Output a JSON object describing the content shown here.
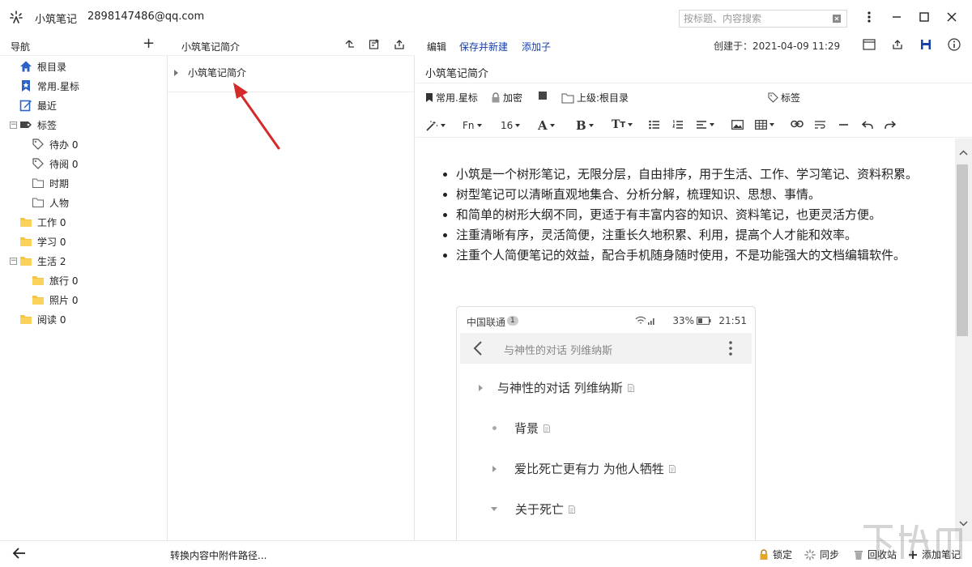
{
  "app": {
    "title": "小筑笔记",
    "user_email": "2898147486@qq.com",
    "search_placeholder": "按标题、内容搜索"
  },
  "nav": {
    "header": "导航",
    "items": [
      {
        "label": "根目录",
        "icon": "home-icon",
        "level": 0
      },
      {
        "label": "常用.星标",
        "icon": "bookmark-star-icon",
        "level": 0
      },
      {
        "label": "最近",
        "icon": "edit-recent-icon",
        "level": 0
      },
      {
        "label": "标签",
        "icon": "tag-filled-icon",
        "level": 0,
        "expanded": true
      },
      {
        "label": "待办 0",
        "icon": "tag-outline-icon",
        "level": 1
      },
      {
        "label": "待阅 0",
        "icon": "tag-outline-icon",
        "level": 1
      },
      {
        "label": "时期",
        "icon": "folder-outline-icon",
        "level": 1
      },
      {
        "label": "人物",
        "icon": "folder-outline-icon",
        "level": 1
      },
      {
        "label": "工作 0",
        "icon": "folder-icon",
        "level": 0
      },
      {
        "label": "学习 0",
        "icon": "folder-icon",
        "level": 0
      },
      {
        "label": "生活 2",
        "icon": "folder-icon",
        "level": 0,
        "expanded": true
      },
      {
        "label": "旅行 0",
        "icon": "folder-icon",
        "level": 1
      },
      {
        "label": "照片 0",
        "icon": "folder-icon",
        "level": 1
      },
      {
        "label": "阅读 0",
        "icon": "folder-icon",
        "level": 0
      }
    ]
  },
  "tree": {
    "header": "小筑笔记简介",
    "nodes": [
      {
        "label": "小筑笔记简介"
      }
    ]
  },
  "editor": {
    "edit_label": "编辑",
    "save_new_label": "保存并新建",
    "add_child_label": "添加子",
    "created_at": "创建于：2021-04-09 11:29",
    "title": "小筑笔记简介",
    "meta": {
      "star": "常用.星标",
      "encrypt": "加密",
      "parent": "上级:根目录",
      "tags": "标签"
    },
    "format": {
      "font_fn": "Fn",
      "font_size": "16"
    },
    "bullets": [
      "小筑是一个树形笔记，无限分层，自由排序，用于生活、工作、学习笔记、资料积累。",
      "树型笔记可以清晰直观地集合、分析分解，梳理知识、思想、事情。",
      "和简单的树形大纲不同，更适于有丰富内容的知识、资料笔记，也更灵活方便。",
      "注重清晰有序，灵活简便，注重长久地积累、利用，提高个人才能和效率。",
      "注重个人简便笔记的效益，配合手机随身随时使用，不是功能强大的文档编辑软件。"
    ],
    "phone": {
      "carrier": "中国联通",
      "sim": "1",
      "battery": "33%",
      "time": "21:51",
      "appbar_title": "与神性的对话  列维纳斯",
      "rows": [
        {
          "label": "与神性的对话  列维纳斯",
          "marker": "caret-right"
        },
        {
          "label": "背景",
          "marker": "dot"
        },
        {
          "label": "爱比死亡更有力 为他人牺牲",
          "marker": "caret-right"
        },
        {
          "label": "关于死亡",
          "marker": "caret-down"
        }
      ]
    }
  },
  "status": {
    "message": "转换内容中附件路径...",
    "lock": "锁定",
    "sync": "同步",
    "recycle": "回收站",
    "add_note": "添加笔记"
  },
  "colors": {
    "accent_blue": "#1a3fa8",
    "folder_yellow": "#f6c343",
    "annotation_red": "#d42a2a"
  }
}
